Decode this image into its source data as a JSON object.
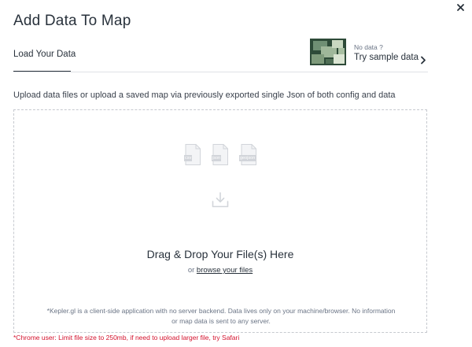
{
  "modal": {
    "title": "Add Data To Map"
  },
  "tabs": {
    "load_label": "Load Your Data"
  },
  "sample": {
    "caption": "No data ?",
    "link_label": "Try sample data"
  },
  "description": "Upload data files or upload a saved map via previously exported single Json of both config and data",
  "dropzone": {
    "file_types": [
      "csv",
      "json",
      "geojson"
    ],
    "heading": "Drag & Drop Your File(s) Here",
    "or_text": "or",
    "browse_label": "browse your files",
    "disclaimer_line1": "*Kepler.gl is a client-side application with no server backend. Data lives only on your machine/browser. No information",
    "disclaimer_line2": "or map data is sent to any server."
  },
  "warning": "*Chrome user: Limit file size to 250mb, if need to upload larger file, try Safari",
  "colors": {
    "accent": "#29323c",
    "warning": "#d4112c",
    "icon_gray": "#d2d5da"
  },
  "icons": {
    "close": "close-icon",
    "chevron": "chevron-right-icon",
    "file": "file-icon",
    "drop": "download-icon"
  }
}
